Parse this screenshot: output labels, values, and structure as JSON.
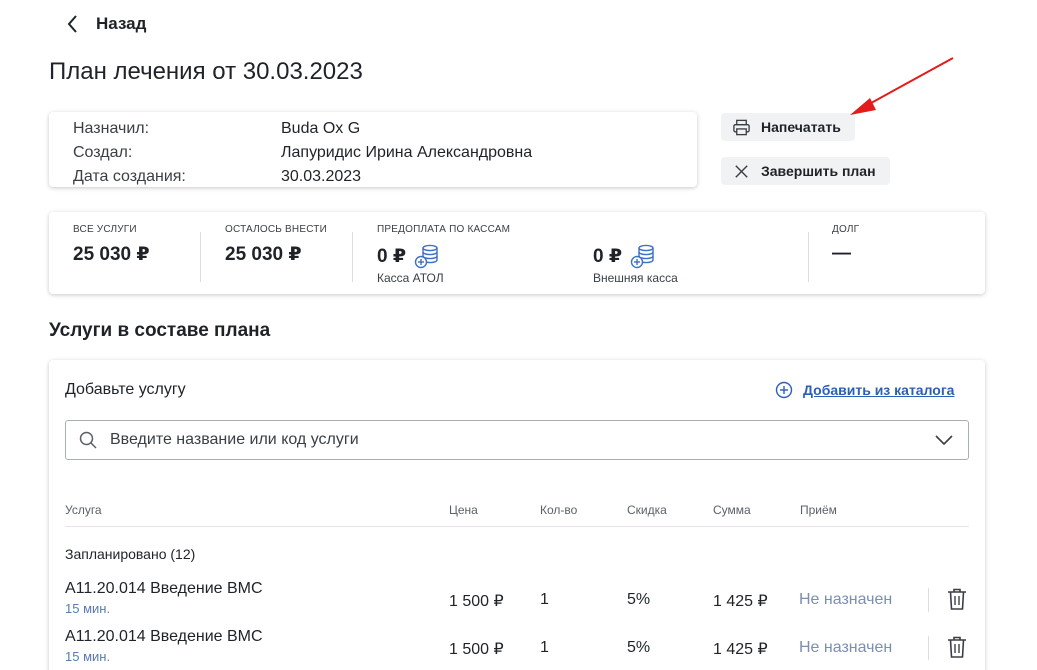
{
  "nav": {
    "back_label": "Назад"
  },
  "page": {
    "title": "План лечения от 30.03.2023"
  },
  "info": [
    {
      "key": "Назначил:",
      "value": "Buda Ox G"
    },
    {
      "key": "Создал:",
      "value": "Лапуридис Ирина Александровна"
    },
    {
      "key": "Дата создания:",
      "value": "30.03.2023"
    }
  ],
  "actions": {
    "print_label": "Напечатать",
    "finish_label": "Завершить план"
  },
  "stats": {
    "all_services": {
      "caption": "ВСЕ УСЛУГИ",
      "value": "25 030 ₽"
    },
    "remaining": {
      "caption": "ОСТАЛОСЬ ВНЕСТИ",
      "value": "25 030 ₽"
    },
    "prepay_caption": "ПРЕДОПЛАТА ПО КАССАМ",
    "prepay_atol": {
      "value": "0 ₽",
      "label": "Касса АТОЛ"
    },
    "prepay_external": {
      "value": "0 ₽",
      "label": "Внешняя касса"
    },
    "debt": {
      "caption": "ДОЛГ",
      "value": "—"
    }
  },
  "services": {
    "section_title": "Услуги в составе плана",
    "add_label": "Добавьте услугу",
    "catalog_link": "Добавить из каталога",
    "search_placeholder": "Введите название или код услуги",
    "columns": {
      "service": "Услуга",
      "price": "Цена",
      "qty": "Кол-во",
      "discount": "Скидка",
      "sum": "Сумма",
      "visit": "Приём"
    },
    "group_label": "Запланировано (12)",
    "rows": [
      {
        "name": "A11.20.014 Введение ВМС",
        "duration": "15 мин.",
        "price": "1 500 ₽",
        "qty": "1",
        "discount": "5%",
        "sum": "1 425 ₽",
        "status": "Не назначен"
      },
      {
        "name": "A11.20.014 Введение ВМС",
        "duration": "15 мин.",
        "price": "1 500 ₽",
        "qty": "1",
        "discount": "5%",
        "sum": "1 425 ₽",
        "status": "Не назначен"
      }
    ]
  },
  "colors": {
    "link": "#2b5fb3",
    "status": "#7a8fb4",
    "annotation_arrow": "#e31b1b",
    "coin_icon": "#3d6fc4"
  }
}
